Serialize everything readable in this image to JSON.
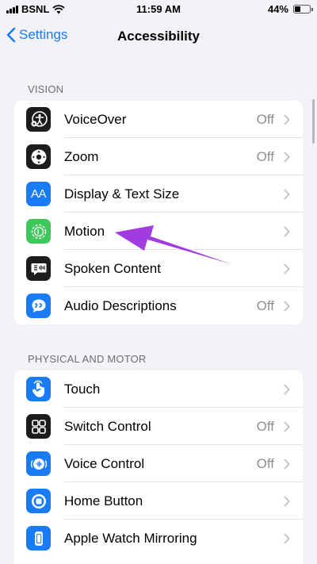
{
  "status_bar": {
    "carrier": "BSNL",
    "time": "11:59 AM",
    "battery_percent": "44%",
    "battery_level": 0.44
  },
  "nav": {
    "back_label": "Settings",
    "title": "Accessibility"
  },
  "sections": [
    {
      "header": "VISION",
      "items": [
        {
          "label": "VoiceOver",
          "value": "Off",
          "icon": "voiceover-icon",
          "color": "#1c1c1e"
        },
        {
          "label": "Zoom",
          "value": "Off",
          "icon": "zoom-icon",
          "color": "#1c1c1e"
        },
        {
          "label": "Display & Text Size",
          "value": "",
          "icon": "text-size-icon",
          "color": "#1a7cf5",
          "icon_text": "AA"
        },
        {
          "label": "Motion",
          "value": "",
          "icon": "motion-icon",
          "color": "#3ec75a"
        },
        {
          "label": "Spoken Content",
          "value": "",
          "icon": "spoken-content-icon",
          "color": "#1c1c1e"
        },
        {
          "label": "Audio Descriptions",
          "value": "Off",
          "icon": "audio-descriptions-icon",
          "color": "#1a7cf5"
        }
      ]
    },
    {
      "header": "PHYSICAL AND MOTOR",
      "items": [
        {
          "label": "Touch",
          "value": "",
          "icon": "touch-icon",
          "color": "#1a7cf5"
        },
        {
          "label": "Switch Control",
          "value": "Off",
          "icon": "switch-control-icon",
          "color": "#1c1c1e"
        },
        {
          "label": "Voice Control",
          "value": "Off",
          "icon": "voice-control-icon",
          "color": "#1a7cf5"
        },
        {
          "label": "Home Button",
          "value": "",
          "icon": "home-button-icon",
          "color": "#1a7cf5"
        },
        {
          "label": "Apple Watch Mirroring",
          "value": "",
          "icon": "apple-watch-icon",
          "color": "#1a7cf5"
        }
      ]
    }
  ],
  "annotation_color": "#a23be0"
}
